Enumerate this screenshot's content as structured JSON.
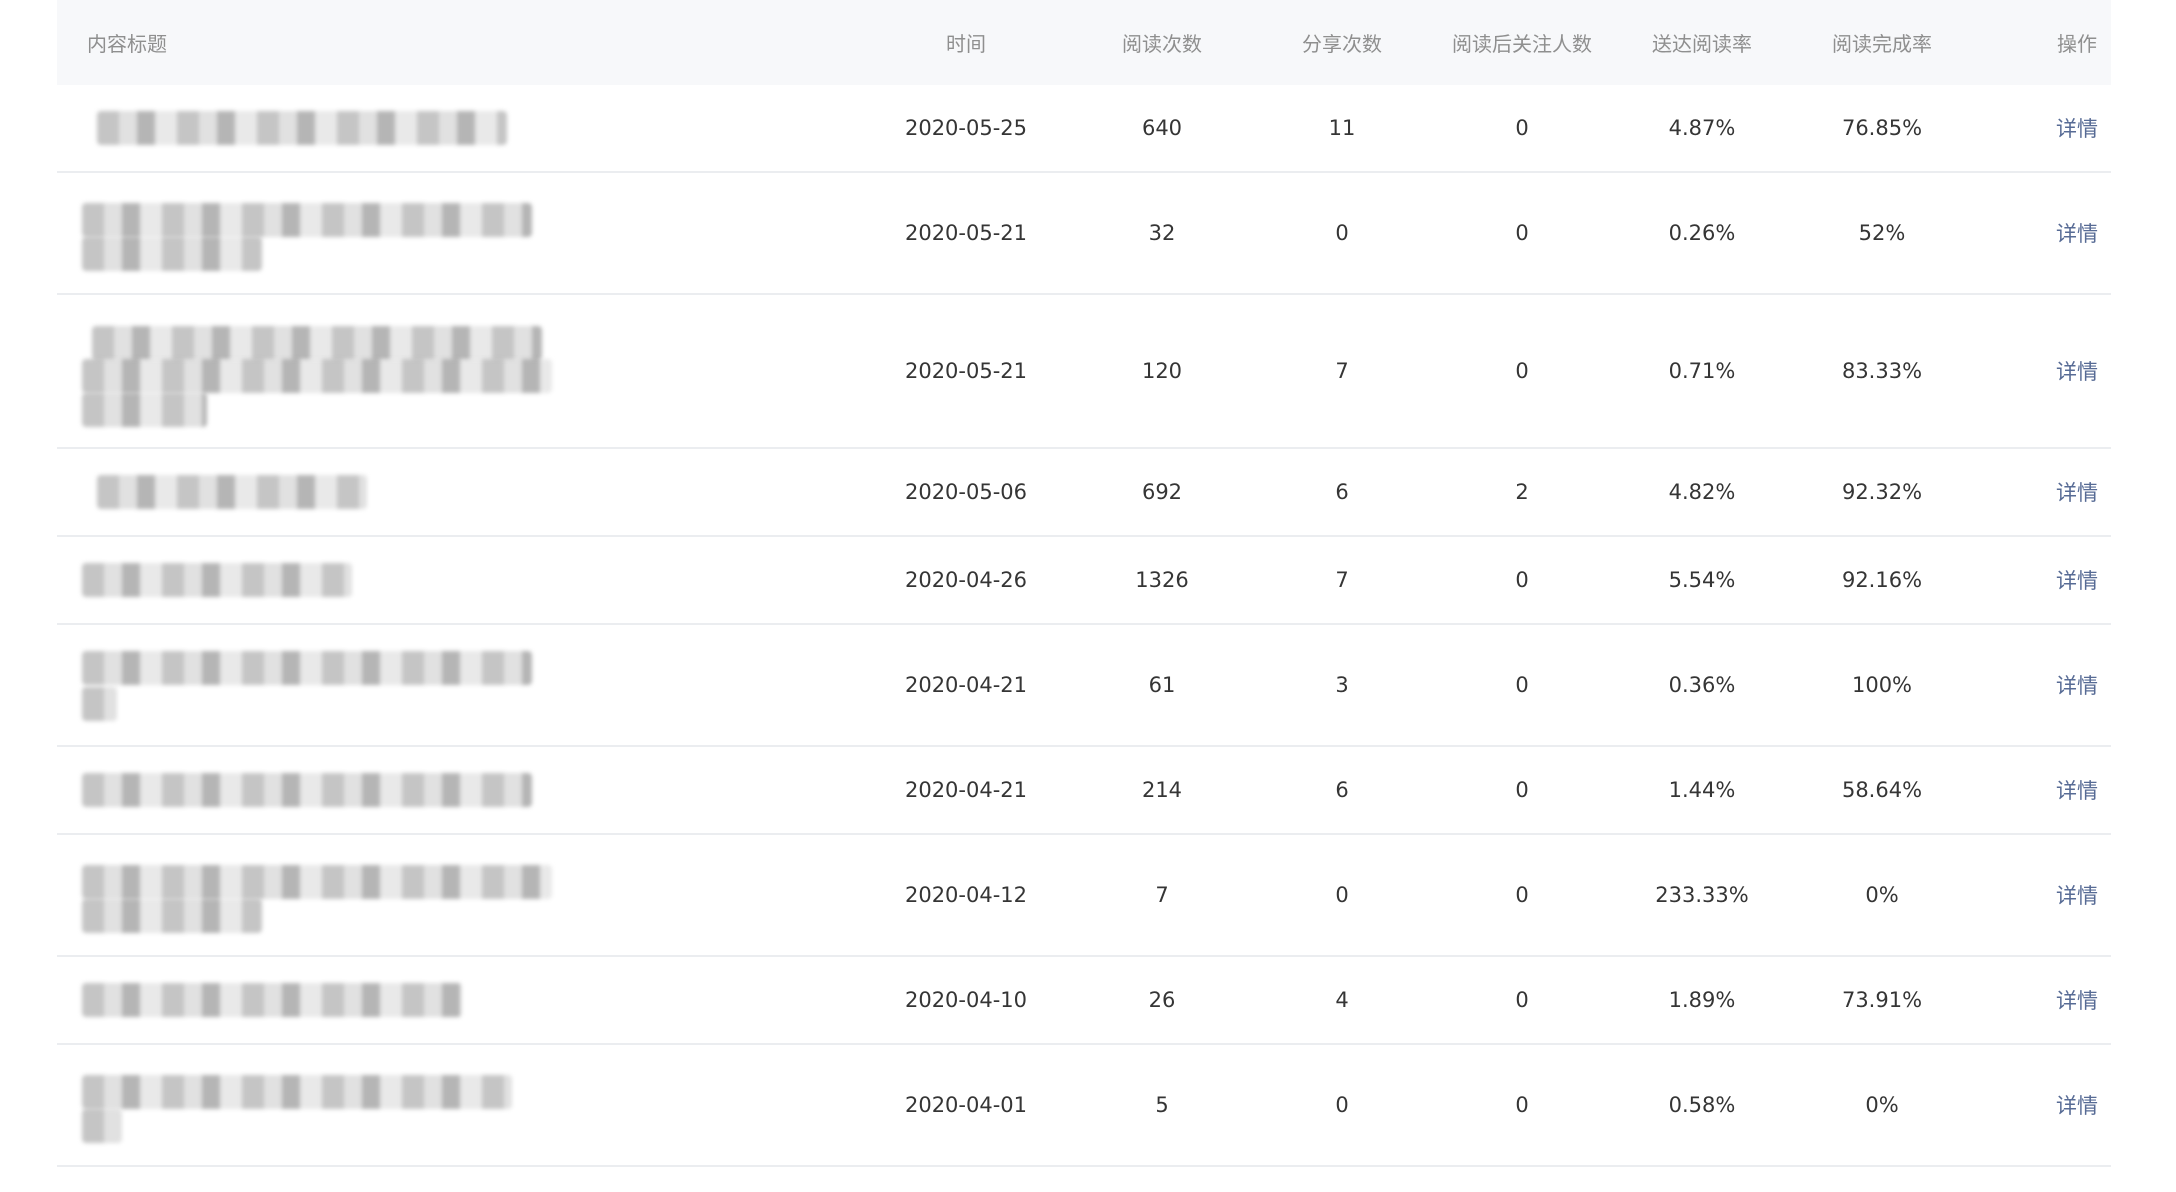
{
  "header": {
    "title": "内容标题",
    "time": "时间",
    "reads": "阅读次数",
    "shares": "分享次数",
    "follows": "阅读后关注人数",
    "delivery_rate": "送达阅读率",
    "completion_rate": "阅读完成率",
    "action": "操作"
  },
  "rows": [
    {
      "time": "2020-05-25",
      "reads": "640",
      "shares": "11",
      "follows": "0",
      "delivery_rate": "4.87%",
      "completion_rate": "76.85%",
      "action": "详情"
    },
    {
      "time": "2020-05-21",
      "reads": "32",
      "shares": "0",
      "follows": "0",
      "delivery_rate": "0.26%",
      "completion_rate": "52%",
      "action": "详情"
    },
    {
      "time": "2020-05-21",
      "reads": "120",
      "shares": "7",
      "follows": "0",
      "delivery_rate": "0.71%",
      "completion_rate": "83.33%",
      "action": "详情"
    },
    {
      "time": "2020-05-06",
      "reads": "692",
      "shares": "6",
      "follows": "2",
      "delivery_rate": "4.82%",
      "completion_rate": "92.32%",
      "action": "详情"
    },
    {
      "time": "2020-04-26",
      "reads": "1326",
      "shares": "7",
      "follows": "0",
      "delivery_rate": "5.54%",
      "completion_rate": "92.16%",
      "action": "详情"
    },
    {
      "time": "2020-04-21",
      "reads": "61",
      "shares": "3",
      "follows": "0",
      "delivery_rate": "0.36%",
      "completion_rate": "100%",
      "action": "详情"
    },
    {
      "time": "2020-04-21",
      "reads": "214",
      "shares": "6",
      "follows": "0",
      "delivery_rate": "1.44%",
      "completion_rate": "58.64%",
      "action": "详情"
    },
    {
      "time": "2020-04-12",
      "reads": "7",
      "shares": "0",
      "follows": "0",
      "delivery_rate": "233.33%",
      "completion_rate": "0%",
      "action": "详情"
    },
    {
      "time": "2020-04-10",
      "reads": "26",
      "shares": "4",
      "follows": "0",
      "delivery_rate": "1.89%",
      "completion_rate": "73.91%",
      "action": "详情"
    },
    {
      "time": "2020-04-01",
      "reads": "5",
      "shares": "0",
      "follows": "0",
      "delivery_rate": "0.58%",
      "completion_rate": "0%",
      "action": "详情"
    }
  ],
  "colors": {
    "header_bg": "#f7f8fa",
    "header_text": "#8f8f8f",
    "cell_text": "#353535",
    "link": "#576b95",
    "divider": "#ebedf0"
  }
}
